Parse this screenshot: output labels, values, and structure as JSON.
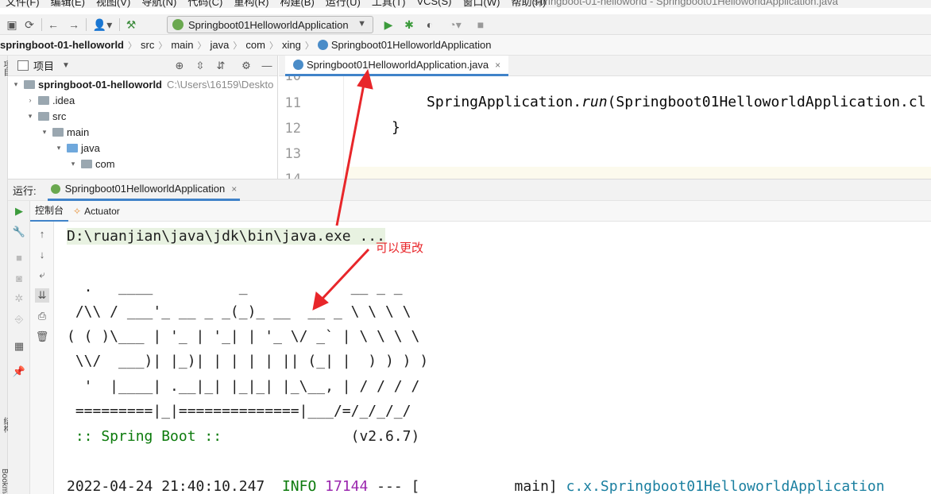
{
  "window": {
    "menus": [
      "文件(F)",
      "编辑(E)",
      "视图(V)",
      "导航(N)",
      "代码(C)",
      "重构(R)",
      "构建(B)",
      "运行(U)",
      "工具(T)",
      "VCS(S)",
      "窗口(W)",
      "帮助(H)"
    ],
    "title": "springboot-01-helloworld - Springboot01HelloworldApplication.java"
  },
  "toolbar": {
    "run_config": "Springboot01HelloworldApplication",
    "icons": [
      "save-icon",
      "sync-icon",
      "back-icon",
      "forward-icon",
      "user-icon",
      "build-hammer-icon",
      "run-icon",
      "debug-icon",
      "coverage-icon",
      "profile-icon",
      "stop-icon"
    ]
  },
  "breadcrumb": [
    "springboot-01-helloworld",
    "src",
    "main",
    "java",
    "com",
    "xing",
    "Springboot01HelloworldApplication"
  ],
  "project_panel": {
    "title": "项目",
    "tree": [
      {
        "label": "springboot-01-helloworld",
        "path": "C:\\Users\\16159\\Deskto",
        "expanded": true
      },
      {
        "label": ".idea",
        "expanded": false
      },
      {
        "label": "src",
        "expanded": true
      },
      {
        "label": "main",
        "expanded": true
      },
      {
        "label": "java",
        "expanded": true
      },
      {
        "label": "com",
        "expanded": true
      }
    ]
  },
  "editor": {
    "tab": "Springboot01HelloworldApplication.java",
    "line_numbers": [
      "10",
      "11",
      "12",
      "13",
      "14"
    ],
    "lines": {
      "l11_pre": "SpringApplication.",
      "l11_method": "run",
      "l11_post": "(Springboot01HelloworldApplication.cl",
      "l12": "}"
    }
  },
  "run_window": {
    "label": "运行:",
    "tab": "Springboot01HelloworldApplication",
    "subtabs": [
      "控制台",
      "Actuator"
    ]
  },
  "console": {
    "cmd": "D:\\ruanjian\\java\\jdk\\bin\\java.exe ...",
    "banner": [
      "  .   ____          _            __ _ _",
      " /\\\\ / ___'_ __ _ _(_)_ __  __ _ \\ \\ \\ \\",
      "( ( )\\___ | '_ | '_| | '_ \\/ _` | \\ \\ \\ \\",
      " \\\\/  ___)| |_)| | | | | || (_| |  ) ) ) )",
      "  '  |____| .__|_| |_|_| |_\\__, | / / / /",
      " =========|_|==============|___/=/_/_/_/"
    ],
    "spring_label": " :: Spring Boot :: ",
    "spring_version": "              (v2.6.7)",
    "log": {
      "timestamp": "2022-04-24 21:40:10.247",
      "level": "INFO",
      "pid": "17144",
      "sep": " --- [           main] ",
      "logger": "c.x.Springboot01HelloworldApplication"
    }
  },
  "annotation": {
    "text": "可以更改",
    "color": "#e8262a"
  }
}
